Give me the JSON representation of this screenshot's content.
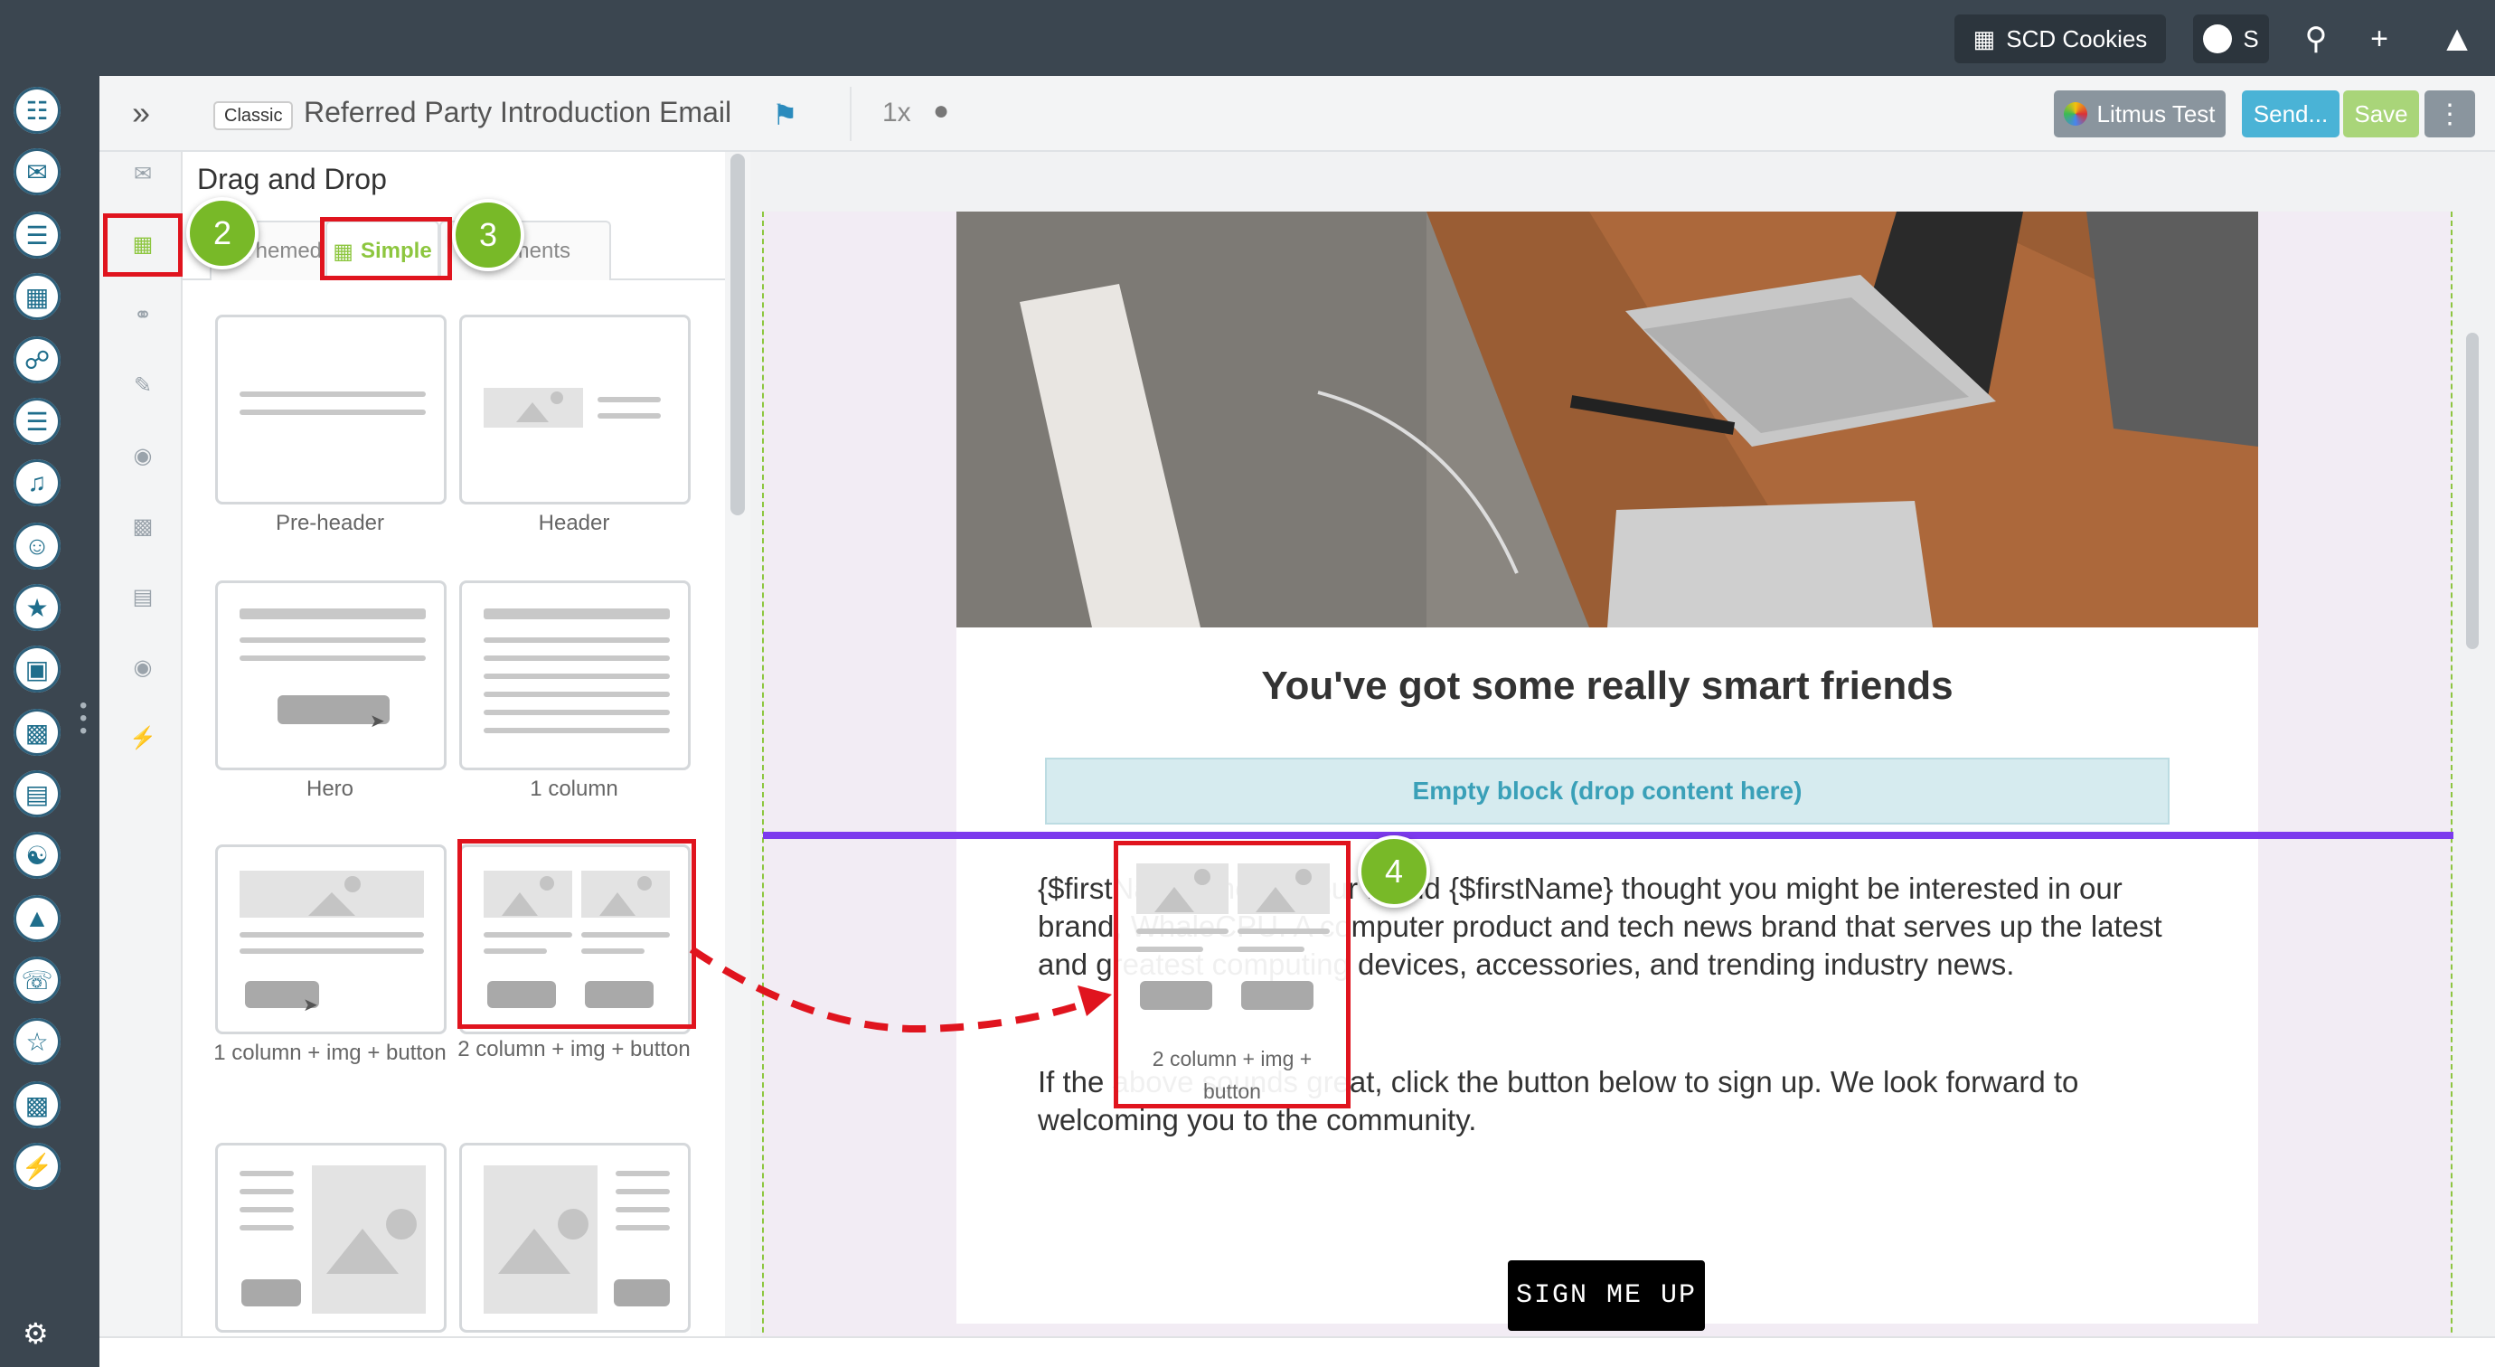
{
  "topbar": {
    "workspace_label": "SCD Cookies",
    "user_initial": "S"
  },
  "rail": {
    "items": [
      "contacts-icon",
      "email-icon",
      "forms-icon",
      "map-icon",
      "workflow-icon",
      "lists-icon",
      "campaigns-icon",
      "chat-icon",
      "likes-icon",
      "media-icon",
      "gallery-icon",
      "calendar-icon",
      "partners-icon",
      "analytics-icon",
      "support-icon",
      "users-star-icon",
      "reports-icon",
      "plugins-icon"
    ]
  },
  "editor_header": {
    "badge": "Classic",
    "title": "Referred Party Introduction Email",
    "zoom": "1x",
    "litmus_label": "Litmus Test",
    "send_label": "Send...",
    "save_label": "Save"
  },
  "panel": {
    "title": "Drag and Drop",
    "tabs": [
      {
        "label": "Themed"
      },
      {
        "label": "Simple"
      },
      {
        "label": "Elements"
      }
    ],
    "blocks": [
      {
        "label": "Pre-header"
      },
      {
        "label": "Header"
      },
      {
        "label": "Hero"
      },
      {
        "label": "1 column"
      },
      {
        "label": "1 column + img + button"
      },
      {
        "label": "2 column + img + button"
      }
    ]
  },
  "email": {
    "headline": "You've got some really smart friends",
    "empty_block": "Empty block (drop content here)",
    "paragraph1": "{$firstName}, hello! Your friend {$firstName} thought you might be interested in our brand, WhaleCPU. A computer product and tech news brand that serves up the latest and greatest computing devices, accessories, and trending industry news.",
    "paragraph2": "If the above sounds great, click the button below to sign up. We look forward to welcoming you to the community.",
    "button": "SIGN ME UP"
  },
  "overlays": {
    "steps": [
      "2",
      "3",
      "4"
    ],
    "drag_label": "2 column + img + button"
  },
  "colors": {
    "accent_green": "#8dc63f",
    "drop_line": "#7c3aed",
    "highlight_red": "#e0141e",
    "send_blue": "#4ab3d6"
  }
}
